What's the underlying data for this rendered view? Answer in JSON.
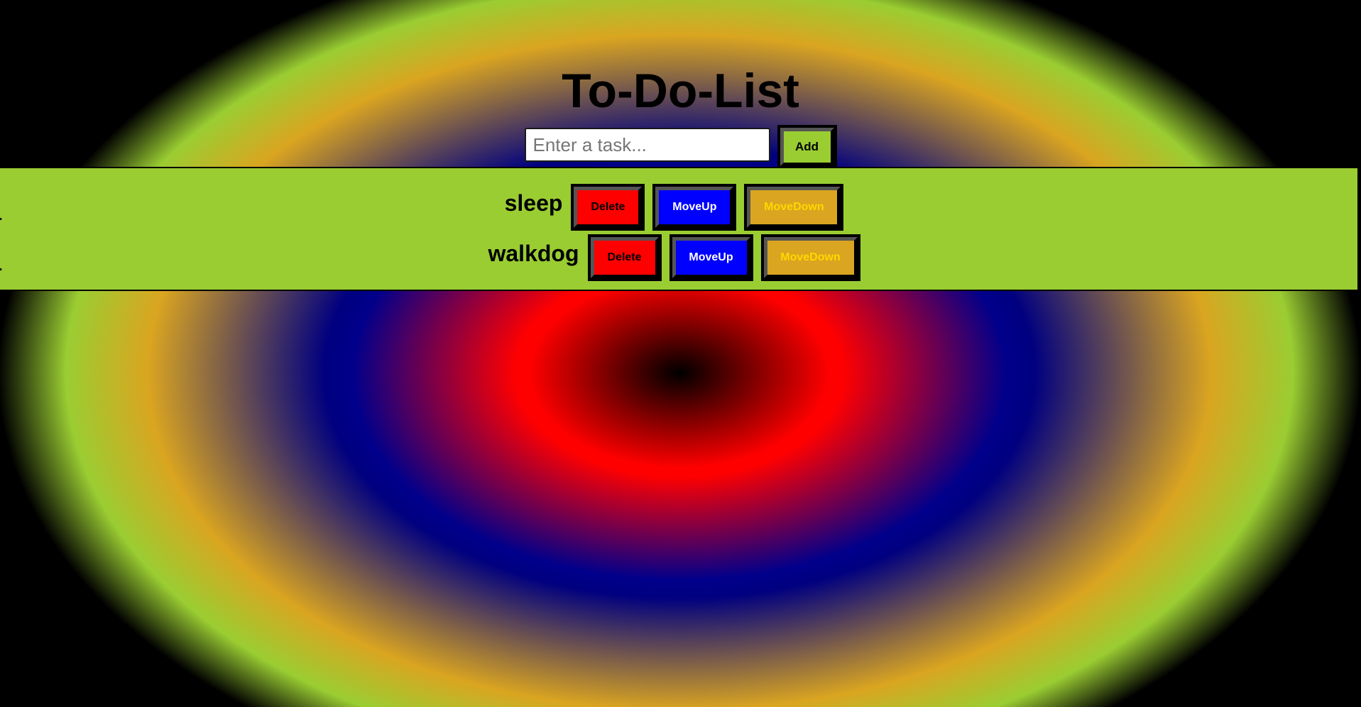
{
  "app": {
    "title": "To-Do-List"
  },
  "input": {
    "placeholder": "Enter a task...",
    "value": ""
  },
  "buttons": {
    "add_label": "Add",
    "delete_label": "Delete",
    "move_up_label": "MoveUp",
    "move_down_label": "MoveDown"
  },
  "tasks": [
    {
      "name": "sleep"
    },
    {
      "name": "walkdog"
    }
  ],
  "colors": {
    "panel": "#9acd32",
    "delete": "#ff0000",
    "move_up": "#0000ff",
    "move_down": "#daa520",
    "move_down_text": "#ffd700"
  }
}
